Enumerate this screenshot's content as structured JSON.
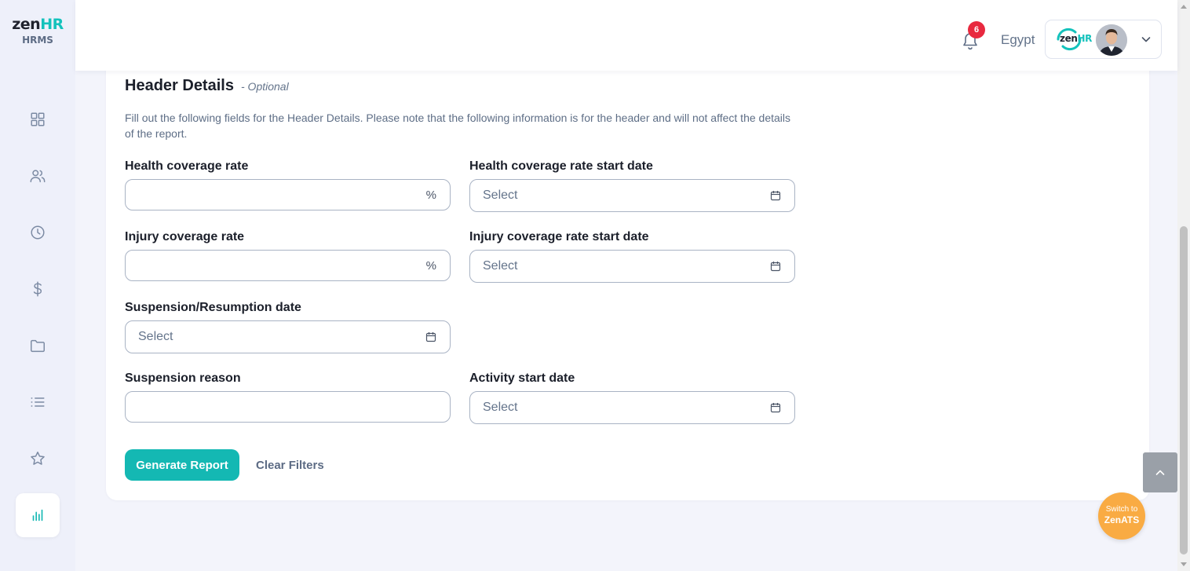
{
  "app": {
    "logo_main": "zen",
    "logo_accent": "HR",
    "logo_sub": "HRMS"
  },
  "sidebar": {
    "items": [
      {
        "icon": "dashboard-grid-icon"
      },
      {
        "icon": "people-icon"
      },
      {
        "icon": "clock-icon"
      },
      {
        "icon": "dollar-icon"
      },
      {
        "icon": "folder-icon"
      },
      {
        "icon": "list-icon"
      },
      {
        "icon": "star-icon"
      },
      {
        "icon": "bar-chart-icon",
        "active": true
      }
    ]
  },
  "header": {
    "notification_count": "6",
    "country": "Egypt",
    "company_logo_main": "zen",
    "company_logo_accent": "HR"
  },
  "form": {
    "title": "Header Details",
    "optional": "- Optional",
    "description": "Fill out the following fields for the Header Details. Please note that the following information is for the header and will not affect the details of the report.",
    "health_rate_label": "Health coverage rate",
    "health_rate_suffix": "%",
    "health_start_label": "Health coverage rate start date",
    "health_start_placeholder": "Select",
    "injury_rate_label": "Injury coverage rate",
    "injury_rate_suffix": "%",
    "injury_start_label": "Injury coverage rate start date",
    "injury_start_placeholder": "Select",
    "suspension_date_label": "Suspension/Resumption date",
    "suspension_date_placeholder": "Select",
    "suspension_reason_label": "Suspension reason",
    "activity_start_label": "Activity start date",
    "activity_start_placeholder": "Select",
    "generate_label": "Generate Report",
    "clear_label": "Clear Filters"
  },
  "switch_ats": {
    "line1": "Switch to",
    "line2": "ZenATS"
  },
  "colors": {
    "accent": "#14b8b3",
    "badge": "#e8293f",
    "switch_ats": "#f9ab43"
  }
}
